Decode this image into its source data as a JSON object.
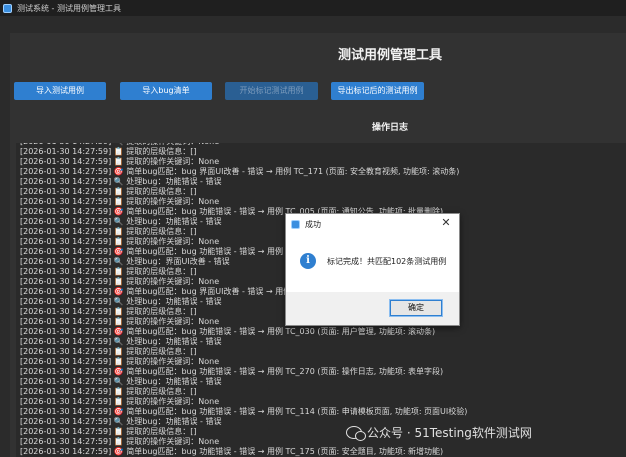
{
  "window": {
    "title": "测试系统 - 测试用例管理工具"
  },
  "header": {
    "title": "测试用例管理工具"
  },
  "toolbar": {
    "buttons": [
      {
        "label": "导入测试用例",
        "enabled": true
      },
      {
        "label": "导入bug清单",
        "enabled": true
      },
      {
        "label": "开始标记测试用例",
        "enabled": false
      },
      {
        "label": "导出标记后的测试用例",
        "enabled": true
      }
    ]
  },
  "log": {
    "title": "操作日志",
    "lines": [
      "[2026-01-30 14:27:59] 🔍 提取的操作关键词：None",
      "[2026-01-30 14:27:59] 📋 提取的层级信息：[]",
      "[2026-01-30 14:27:59] 📋 提取的操作关键词：None",
      "[2026-01-30 14:27:59] 🎯 简单bug匹配：bug 界面UI改善 - 错误 → 用例 TC_171 (页面: 安全教育视频, 功能项: 滚动条)",
      "[2026-01-30 14:27:59] 🔍 处理bug：功能错误 - 错误",
      "[2026-01-30 14:27:59] 📋 提取的层级信息：[]",
      "[2026-01-30 14:27:59] 📋 提取的操作关键词：None",
      "[2026-01-30 14:27:59] 🎯 简单bug匹配：bug 功能错误 - 错误 → 用例 TC_005 (页面: 通知公告, 功能项: 批量删除)",
      "[2026-01-30 14:27:59] 🔍 处理bug：功能错误 - 错误",
      "[2026-01-30 14:27:59] 📋 提取的层级信息：[]",
      "[2026-01-30 14:27:59] 📋 提取的操作关键词：None",
      "[2026-01-30 14:27:59] 🎯 简单bug匹配：bug 功能错误 - 错误 → 用例 TC_",
      "[2026-01-30 14:27:59] 🔍 处理bug：界面UI改善 - 错误",
      "[2026-01-30 14:27:59] 📋 提取的层级信息：[]",
      "[2026-01-30 14:27:59] 📋 提取的操作关键词：None",
      "[2026-01-30 14:27:59] 🎯 简单bug匹配：bug 界面UI改善 - 错误 → 用例 T",
      "[2026-01-30 14:27:59] 🔍 处理bug：功能错误 - 错误",
      "[2026-01-30 14:27:59] 📋 提取的层级信息：[]",
      "[2026-01-30 14:27:59] 📋 提取的操作关键词：None",
      "[2026-01-30 14:27:59] 🎯 简单bug匹配：bug 功能错误 - 错误 → 用例 TC_030 (页面: 用户管理, 功能项: 滚动条)",
      "[2026-01-30 14:27:59] 🔍 处理bug：功能错误 - 错误",
      "[2026-01-30 14:27:59] 📋 提取的层级信息：[]",
      "[2026-01-30 14:27:59] 📋 提取的操作关键词：None",
      "[2026-01-30 14:27:59] 🎯 简单bug匹配：bug 功能错误 - 错误 → 用例 TC_270 (页面: 操作日志, 功能项: 表单字段)",
      "[2026-01-30 14:27:59] 🔍 处理bug：功能错误 - 错误",
      "[2026-01-30 14:27:59] 📋 提取的层级信息：[]",
      "[2026-01-30 14:27:59] 📋 提取的操作关键词：None",
      "[2026-01-30 14:27:59] 🎯 简单bug匹配：bug 功能错误 - 错误 → 用例 TC_114 (页面: 申请模板页面, 功能项: 页面UI校验)",
      "[2026-01-30 14:27:59] 🔍 处理bug：功能错误 - 错误",
      "[2026-01-30 14:27:59] 📋 提取的层级信息：[]",
      "[2026-01-30 14:27:59] 📋 提取的操作关键词：None",
      "[2026-01-30 14:27:59] 🎯 简单bug匹配：bug 功能错误 - 错误 → 用例 TC_175 (页面: 安全题目, 功能项: 新增功能)"
    ]
  },
  "dialog": {
    "title": "成功",
    "message": "标记完成！共匹配102条测试用例",
    "ok_label": "确定",
    "close_glyph": "✕",
    "info_glyph": "i"
  },
  "watermark": {
    "text": "公众号 · 51Testing软件测试网"
  },
  "colors": {
    "accent": "#2f7fd0",
    "background": "#2b2b2b"
  }
}
